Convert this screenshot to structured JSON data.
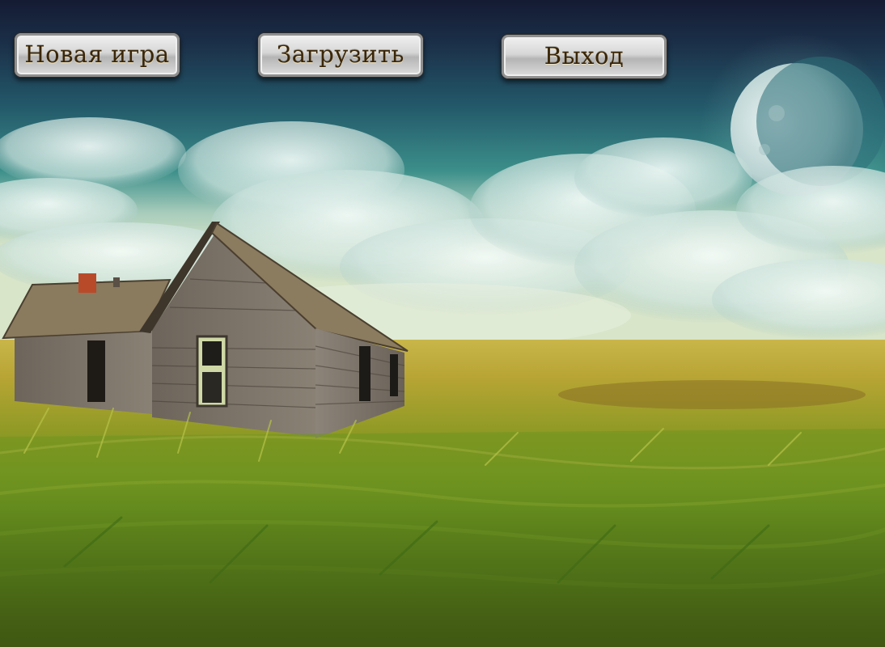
{
  "menu": {
    "new_game_label": "Новая игра",
    "load_label": "Загрузить",
    "exit_label": "Выход"
  },
  "scene": {
    "background_icon": "abandoned-house-field-moon-scene"
  },
  "colors": {
    "sky_top": "#141b33",
    "sky_teal": "#2f7f86",
    "grass_yellow": "#c8b23a",
    "grass_green": "#4f8a1d",
    "button_text": "#3a2608"
  }
}
